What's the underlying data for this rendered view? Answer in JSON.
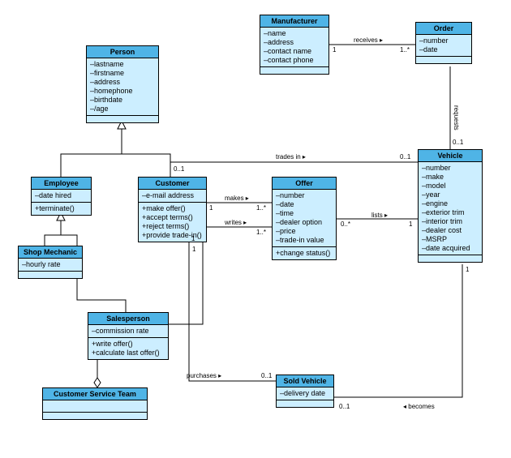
{
  "classes": {
    "person": {
      "name": "Person",
      "attrs": [
        "–lastname",
        "–firstname",
        "–address",
        "–homephone",
        "–birthdate",
        "–/age"
      ],
      "ops": []
    },
    "manufacturer": {
      "name": "Manufacturer",
      "attrs": [
        "–name",
        "–address",
        "–contact name",
        "–contact phone"
      ],
      "ops": []
    },
    "order": {
      "name": "Order",
      "attrs": [
        "–number",
        "–date"
      ],
      "ops": []
    },
    "employee": {
      "name": "Employee",
      "attrs": [
        "–date hired"
      ],
      "ops": [
        "+terminate()"
      ]
    },
    "customer": {
      "name": "Customer",
      "attrs": [
        "–e-mail address"
      ],
      "ops": [
        "+make offer()",
        "+accept terms()",
        "+reject terms()",
        "+provide trade-in()"
      ]
    },
    "offer": {
      "name": "Offer",
      "attrs": [
        "–number",
        "–date",
        "–time",
        "–dealer option",
        "–price",
        "–trade-in value"
      ],
      "ops": [
        "+change status()"
      ]
    },
    "vehicle": {
      "name": "Vehicle",
      "attrs": [
        "–number",
        "–make",
        "–model",
        "–year",
        "–engine",
        "–exterior trim",
        "–interior trim",
        "–dealer cost",
        "–MSRP",
        "–date acquired"
      ],
      "ops": []
    },
    "shopmechanic": {
      "name": "Shop Mechanic",
      "attrs": [
        "–hourly rate"
      ],
      "ops": []
    },
    "salesperson": {
      "name": "Salesperson",
      "attrs": [
        "–commission rate"
      ],
      "ops": [
        "+write offer()",
        "+calculate last offer()"
      ]
    },
    "cst": {
      "name": "Customer Service Team",
      "attrs": [],
      "ops": []
    },
    "soldvehicle": {
      "name": "Sold Vehicle",
      "attrs": [
        "–delivery date"
      ],
      "ops": []
    }
  },
  "assoc": {
    "receives": {
      "label": "receives ▸",
      "m1": "1",
      "m2": "1..*"
    },
    "requests": {
      "label": "requests",
      "m1": "0..1",
      "m2": ""
    },
    "tradesin": {
      "label": "trades in ▸",
      "m1": "0..1",
      "m2": "0..1"
    },
    "makes": {
      "label": "makes ▸",
      "m1": "1",
      "m2": "1..*"
    },
    "lists": {
      "label": "lists ▸",
      "m1": "0..*",
      "m2": "1"
    },
    "writes": {
      "label": "writes ▸",
      "m1": "1",
      "m2": "1..*"
    },
    "purchases": {
      "label": "purchases ▸",
      "m1": "1",
      "m2": "0..1"
    },
    "becomes": {
      "label": "◂ becomes",
      "m1": "0..1",
      "m2": "1"
    }
  },
  "chart_data": {
    "type": "uml-class-diagram",
    "classes": [
      {
        "name": "Person",
        "attributes": [
          "lastname",
          "firstname",
          "address",
          "homephone",
          "birthdate",
          "/age"
        ],
        "operations": []
      },
      {
        "name": "Manufacturer",
        "attributes": [
          "name",
          "address",
          "contact name",
          "contact phone"
        ],
        "operations": []
      },
      {
        "name": "Order",
        "attributes": [
          "number",
          "date"
        ],
        "operations": []
      },
      {
        "name": "Employee",
        "attributes": [
          "date hired"
        ],
        "operations": [
          "terminate()"
        ]
      },
      {
        "name": "Customer",
        "attributes": [
          "e-mail address"
        ],
        "operations": [
          "make offer()",
          "accept terms()",
          "reject terms()",
          "provide trade-in()"
        ]
      },
      {
        "name": "Offer",
        "attributes": [
          "number",
          "date",
          "time",
          "dealer option",
          "price",
          "trade-in value"
        ],
        "operations": [
          "change status()"
        ]
      },
      {
        "name": "Vehicle",
        "attributes": [
          "number",
          "make",
          "model",
          "year",
          "engine",
          "exterior trim",
          "interior trim",
          "dealer cost",
          "MSRP",
          "date acquired"
        ],
        "operations": []
      },
      {
        "name": "Shop Mechanic",
        "attributes": [
          "hourly rate"
        ],
        "operations": []
      },
      {
        "name": "Salesperson",
        "attributes": [
          "commission rate"
        ],
        "operations": [
          "write offer()",
          "calculate last offer()"
        ]
      },
      {
        "name": "Customer Service Team",
        "attributes": [],
        "operations": []
      },
      {
        "name": "Sold Vehicle",
        "attributes": [
          "delivery date"
        ],
        "operations": []
      }
    ],
    "relationships": [
      {
        "from": "Employee",
        "to": "Person",
        "type": "generalization"
      },
      {
        "from": "Customer",
        "to": "Person",
        "type": "generalization"
      },
      {
        "from": "Shop Mechanic",
        "to": "Employee",
        "type": "generalization"
      },
      {
        "from": "Salesperson",
        "to": "Employee",
        "type": "generalization"
      },
      {
        "from": "Salesperson",
        "to": "Customer Service Team",
        "type": "aggregation"
      },
      {
        "from": "Manufacturer",
        "to": "Order",
        "type": "association",
        "name": "receives",
        "mult_from": "1",
        "mult_to": "1..*"
      },
      {
        "from": "Order",
        "to": "Vehicle",
        "type": "association",
        "name": "requests",
        "mult_from": "",
        "mult_to": "0..1"
      },
      {
        "from": "Customer",
        "to": "Vehicle",
        "type": "association",
        "name": "trades in",
        "mult_from": "0..1",
        "mult_to": "0..1"
      },
      {
        "from": "Customer",
        "to": "Offer",
        "type": "association",
        "name": "makes",
        "mult_from": "1",
        "mult_to": "1..*"
      },
      {
        "from": "Offer",
        "to": "Vehicle",
        "type": "association",
        "name": "lists",
        "mult_from": "0..*",
        "mult_to": "1"
      },
      {
        "from": "Salesperson",
        "to": "Offer",
        "type": "association",
        "name": "writes",
        "mult_from": "1",
        "mult_to": "1..*"
      },
      {
        "from": "Customer",
        "to": "Sold Vehicle",
        "type": "association",
        "name": "purchases",
        "mult_from": "1",
        "mult_to": "0..1"
      },
      {
        "from": "Vehicle",
        "to": "Sold Vehicle",
        "type": "association",
        "name": "becomes",
        "mult_from": "1",
        "mult_to": "0..1"
      }
    ]
  }
}
